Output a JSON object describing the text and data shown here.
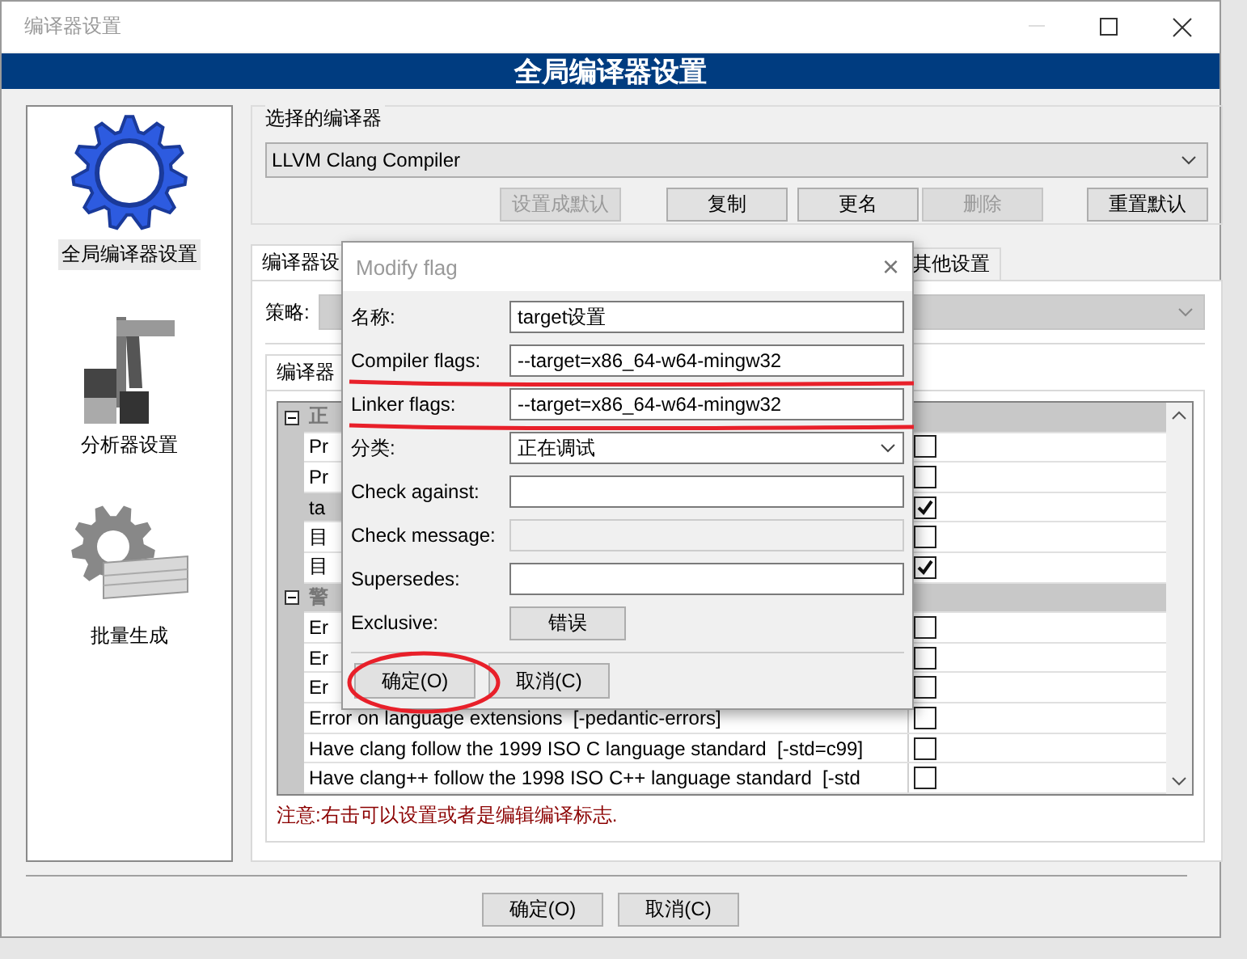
{
  "window": {
    "title": "编译器设置"
  },
  "banner": "全局编译器设置",
  "sidebar": {
    "items": [
      {
        "label": "全局编译器设置",
        "kind": "gear",
        "selected": true
      },
      {
        "label": "分析器设置",
        "kind": "caliper",
        "selected": false
      },
      {
        "label": "批量生成",
        "kind": "batch",
        "selected": false
      }
    ]
  },
  "compiler_group": {
    "title": "选择的编译器",
    "value": "LLVM Clang Compiler",
    "buttons": [
      {
        "label": "设置成默认",
        "disabled": true
      },
      {
        "label": "复制",
        "disabled": false
      },
      {
        "label": "更名",
        "disabled": false
      },
      {
        "label": "删除",
        "disabled": true
      },
      {
        "label": "重置默认",
        "disabled": false
      }
    ]
  },
  "tabs": [
    {
      "label": "编译器设",
      "selected": true
    },
    {
      "label": "其他设置",
      "selected": false
    }
  ],
  "policy": {
    "label": "策略:",
    "disabled": true
  },
  "inner_tabs": [
    {
      "label": "编译器",
      "selected": true
    }
  ],
  "tree": {
    "groups": [
      {
        "label": "正",
        "expanded": true,
        "children": [
          {
            "label": "Pr",
            "checked": false,
            "selected": false
          },
          {
            "label": "Pr",
            "checked": false,
            "selected": false
          },
          {
            "label": "ta",
            "checked": true,
            "selected": true
          },
          {
            "label": "目",
            "checked": false,
            "selected": false
          },
          {
            "label": "目",
            "checked": true,
            "selected": false
          }
        ]
      },
      {
        "label": "警",
        "expanded": true,
        "children": [
          {
            "label": "Er",
            "checked": false,
            "selected": false
          },
          {
            "label": "Er",
            "checked": false,
            "selected": false
          },
          {
            "label": "Er",
            "checked": false,
            "selected": false
          },
          {
            "label": "Error on language extensions  [-pedantic-errors]",
            "checked": false,
            "selected": false
          },
          {
            "label": "Have clang follow the 1999 ISO C language standard  [-std=c99]",
            "checked": false,
            "selected": false
          },
          {
            "label": "Have clang++ follow the 1998 ISO C++ language standard  [-std",
            "checked": false,
            "selected": false
          }
        ]
      }
    ]
  },
  "note": "注意:右击可以设置或者是编辑编译标志.",
  "buttons": [
    "确定(O)",
    "取消(C)"
  ],
  "dialog": {
    "title": "Modify flag",
    "close": "×",
    "fields": [
      {
        "label": "名称:",
        "kind": "text",
        "value": "target设置",
        "highlighted": false
      },
      {
        "label": "Compiler flags:",
        "kind": "text",
        "value": "--target=x86_64-w64-mingw32",
        "highlighted": true
      },
      {
        "label": "Linker flags:",
        "kind": "text",
        "value": "--target=x86_64-w64-mingw32",
        "highlighted": true
      },
      {
        "label": "分类:",
        "kind": "combo",
        "value": "正在调试",
        "highlighted": false
      },
      {
        "label": "Check against:",
        "kind": "text",
        "highlighted": false
      },
      {
        "label": "Check message:",
        "kind": "disabled",
        "highlighted": false
      },
      {
        "label": "Supersedes:",
        "kind": "text",
        "highlighted": false
      },
      {
        "label": "Exclusive:",
        "kind": "button",
        "value": "错误",
        "highlighted": false
      }
    ],
    "buttons": [
      {
        "label": "确定(O)",
        "circled": true
      },
      {
        "label": "取消(C)",
        "circled": false
      }
    ]
  }
}
